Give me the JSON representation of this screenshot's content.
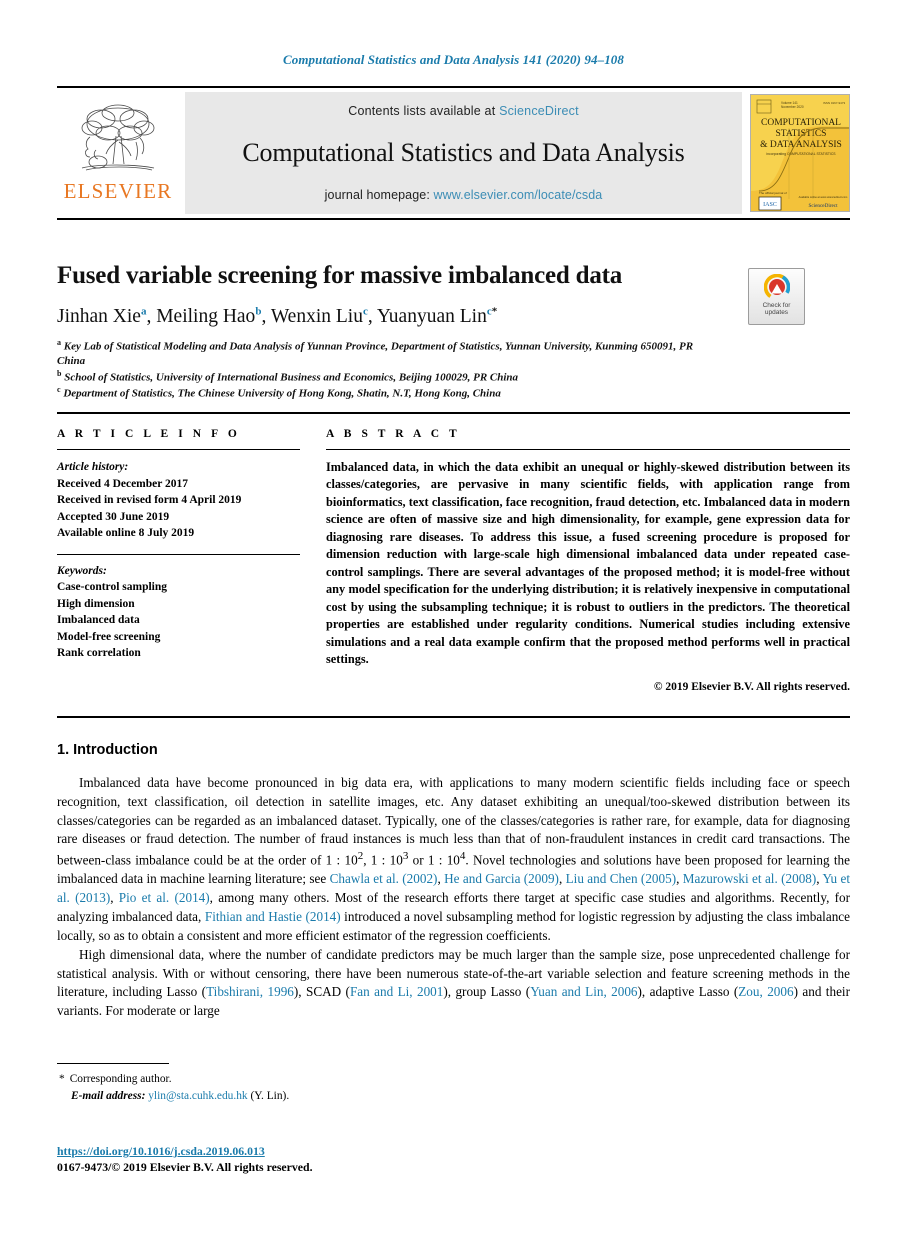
{
  "running_head": "Computational Statistics and Data Analysis 141 (2020) 94–108",
  "masthead": {
    "publisher_logo_text": "ELSEVIER",
    "contents_prefix": "Contents lists available at",
    "contents_link": "ScienceDirect",
    "journal_title": "Computational Statistics and Data Analysis",
    "homepage_prefix": "journal homepage:",
    "homepage_url": "www.elsevier.com/locate/csda",
    "cover": {
      "line1": "COMPUTATIONAL",
      "line2": "STATISTICS",
      "line3": "& DATA ANALYSIS",
      "sublabel": "incorporating  COMPUTATIONAL STATISTICS",
      "official_journal": "The official journal of",
      "sciencedirect": "ScienceDirect",
      "availability": "Available online at www.sciencedirect.com"
    },
    "colors": {
      "link": "#3c8db5",
      "elsevier_orange": "#e87722",
      "cover_yellow": "#f6cf4a",
      "band_gray": "#e8e8e8"
    }
  },
  "article": {
    "title": "Fused variable screening for massive imbalanced data",
    "authors": [
      {
        "name": "Jinhan Xie",
        "marks": "a"
      },
      {
        "name": "Meiling Hao",
        "marks": "b"
      },
      {
        "name": "Wenxin Liu",
        "marks": "c"
      },
      {
        "name": "Yuanyuan Lin",
        "marks": "c",
        "corresponding": "*"
      }
    ],
    "affiliations": [
      {
        "label": "a",
        "text": "Key Lab of Statistical Modeling and Data Analysis of Yunnan Province, Department of Statistics, Yunnan University, Kunming 650091, PR China"
      },
      {
        "label": "b",
        "text": "School of Statistics, University of International Business and Economics, Beijing 100029, PR China"
      },
      {
        "label": "c",
        "text": "Department of Statistics, The Chinese University of Hong Kong, Shatin, N.T, Hong Kong, China"
      }
    ],
    "crossmark": {
      "line1": "Check for",
      "line2": "updates",
      "label": "crossmark-check-for-updates"
    }
  },
  "article_info": {
    "heading": "A R T I C L E  I N F O",
    "history_label": "Article history:",
    "history": [
      "Received 4 December 2017",
      "Received in revised form 4 April 2019",
      "Accepted 30 June 2019",
      "Available online 8 July 2019"
    ],
    "keywords_label": "Keywords:",
    "keywords": [
      "Case-control sampling",
      "High dimension",
      "Imbalanced data",
      "Model-free screening",
      "Rank correlation"
    ]
  },
  "abstract": {
    "heading": "A B S T R A C T",
    "text": "Imbalanced data, in which the data exhibit an unequal or highly-skewed distribution between its classes/categories, are pervasive in many scientific fields, with application range from bioinformatics, text classification, face recognition, fraud detection, etc. Imbalanced data in modern science are often of massive size and high dimensionality, for example, gene expression data for diagnosing rare diseases. To address this issue, a fused screening procedure is proposed for dimension reduction with large-scale high dimensional imbalanced data under repeated case-control samplings. There are several advantages of the proposed method; it is model-free without any model specification for the underlying distribution; it is relatively inexpensive in computational cost by using the subsampling technique; it is robust to outliers in the predictors. The theoretical properties are established under regularity conditions. Numerical studies including extensive simulations and a real data example confirm that the proposed method performs well in practical settings.",
    "copyright": "© 2019 Elsevier B.V. All rights reserved."
  },
  "body": {
    "section_number_title": "1.  Introduction",
    "paragraph1_parts": [
      {
        "t": "Imbalanced data have become pronounced in big data era, with applications to many modern scientific fields including face or speech recognition, text classification, oil detection in satellite images, etc. Any dataset exhibiting an unequal/too-skewed distribution between its classes/categories can be regarded as an imbalanced dataset. Typically, one of the classes/categories is rather rare, for example, data for diagnosing rare diseases or fraud detection. The number of fraud instances is much less than that of non-fraudulent instances in credit card transactions. The between-class imbalance could be at the order of 1 : 10",
        "sup": "2"
      },
      {
        "t": ", 1 : 10",
        "sup": "3"
      },
      {
        "t": " or 1 : 10",
        "sup": "4"
      },
      {
        "t": ". Novel technologies and solutions have been proposed for learning the imbalanced data in machine learning literature; see "
      },
      {
        "t": "Chawla et al. (2002)",
        "link": true
      },
      {
        "t": ", "
      },
      {
        "t": "He and Garcia (2009)",
        "link": true
      },
      {
        "t": ", "
      },
      {
        "t": "Liu and Chen (2005)",
        "link": true
      },
      {
        "t": ", "
      },
      {
        "t": "Mazurowski et al. (2008)",
        "link": true
      },
      {
        "t": ", "
      },
      {
        "t": "Yu et al. (2013)",
        "link": true
      },
      {
        "t": ", "
      },
      {
        "t": "Pio et al. (2014)",
        "link": true
      },
      {
        "t": ", among many others. Most of the research efforts there target at specific case studies and algorithms. Recently, for analyzing imbalanced data, "
      },
      {
        "t": "Fithian and Hastie (2014)",
        "link": true
      },
      {
        "t": " introduced a novel subsampling method for logistic regression by adjusting the class imbalance locally, so as to obtain a consistent and more efficient estimator of the regression coefficients."
      }
    ],
    "paragraph2_parts": [
      {
        "t": "High dimensional data, where the number of candidate predictors may be much larger than the sample size, pose unprecedented challenge for statistical analysis. With or without censoring, there have been numerous state-of-the-art variable selection and feature screening methods in the literature, including Lasso ("
      },
      {
        "t": "Tibshirani, 1996",
        "link": true
      },
      {
        "t": "), SCAD ("
      },
      {
        "t": "Fan and Li, 2001",
        "link": true
      },
      {
        "t": "), group Lasso ("
      },
      {
        "t": "Yuan and Lin, 2006",
        "link": true
      },
      {
        "t": "), adaptive Lasso ("
      },
      {
        "t": "Zou, 2006",
        "link": true
      },
      {
        "t": ") and their variants. For moderate or large"
      }
    ]
  },
  "footnote": {
    "star": "*",
    "corresponding": "Corresponding author.",
    "email_label": "E-mail address:",
    "email": "ylin@sta.cuhk.edu.hk",
    "email_suffix": "(Y. Lin)."
  },
  "footer": {
    "doi": "https://doi.org/10.1016/j.csda.2019.06.013",
    "issn_line": "0167-9473/© 2019 Elsevier B.V. All rights reserved."
  }
}
